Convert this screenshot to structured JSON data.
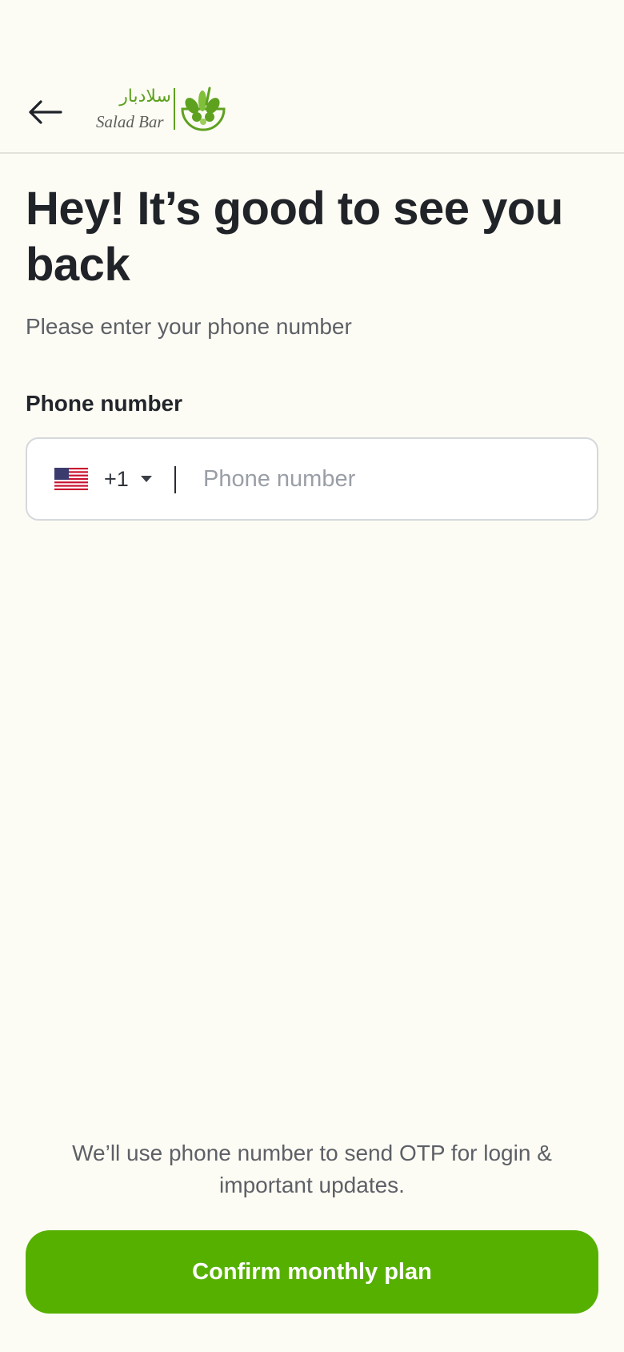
{
  "header": {
    "back_icon": "arrow-left-icon",
    "logo": {
      "arabic_name": "سلادبار",
      "latin_name": "Salad Bar",
      "mark_icon": "salad-bowl-icon",
      "brand_color": "#5ea11f"
    }
  },
  "main": {
    "title": "Hey! It’s good to see you back",
    "subtitle": "Please enter your phone number",
    "phone_field": {
      "label": "Phone number",
      "country_flag_icon": "us-flag-icon",
      "dial_code": "+1",
      "dropdown_icon": "caret-down-icon",
      "value": "",
      "placeholder": "Phone number"
    }
  },
  "footer": {
    "notice": "We’ll use phone number to send OTP for login & important updates.",
    "cta_label": "Confirm monthly plan",
    "cta_color": "#56b000"
  }
}
